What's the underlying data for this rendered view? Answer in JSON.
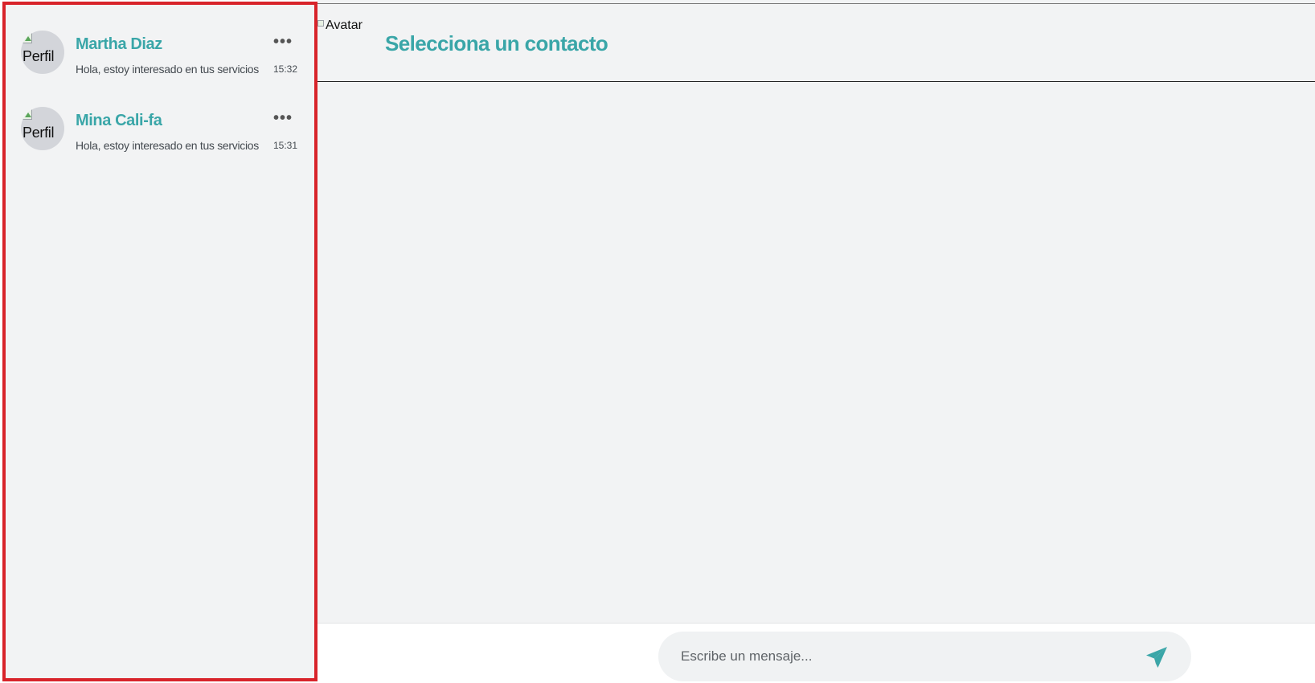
{
  "sidebar": {
    "contacts": [
      {
        "avatar_alt": "Perfil",
        "name": "Martha Diaz",
        "preview": "Hola, estoy interesado en tus servicios",
        "time": "15:32",
        "menu": "•••"
      },
      {
        "avatar_alt": "Perfil",
        "name": "Mina Cali-fa",
        "preview": "Hola, estoy interesado en tus servicios",
        "time": "15:31",
        "menu": "•••"
      }
    ]
  },
  "chat": {
    "header": {
      "avatar_alt": "Avatar",
      "title": "Selecciona un contacto"
    },
    "composer": {
      "placeholder": "Escribe un mensaje...",
      "send_icon": "send-icon"
    }
  },
  "colors": {
    "accent": "#3aa6a8",
    "selection_border": "#d8232a",
    "panel_background": "#f2f3f4"
  }
}
